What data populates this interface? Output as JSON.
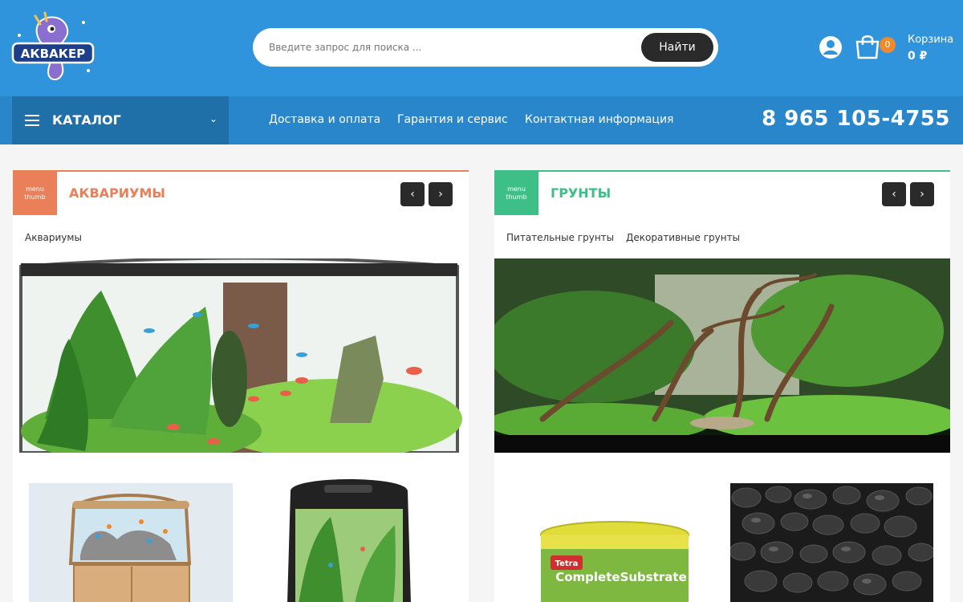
{
  "header": {
    "logo_text": "АКВАКЕР",
    "search": {
      "placeholder": "Введите запрос для поиска ...",
      "button_label": "Найти"
    },
    "cart": {
      "count": "0",
      "label": "Корзина",
      "sum": "0 ₽"
    }
  },
  "nav": {
    "catalog_label": "КАТАЛОГ",
    "links": [
      "Доставка и оплата",
      "Гарантия и сервис",
      "Контактная информация"
    ],
    "phone": "8 965 105-4755"
  },
  "panels": [
    {
      "thumb_label": "menu thumb",
      "title": "АКВАРИУМЫ",
      "subcategories": [
        "Аквариумы"
      ],
      "accent": "#e9805a"
    },
    {
      "thumb_label": "menu thumb",
      "title": "ГРУНТЫ",
      "subcategories": [
        "Питательные грунты",
        "Декоративные грунты"
      ],
      "accent": "#3dbf87"
    }
  ],
  "product_labels": {
    "tetra_brand": "Tetra",
    "tetra_product": "CompleteSubstrate"
  },
  "colors": {
    "header_bg": "#2f94dc",
    "nav_bg": "#2a86cb",
    "catalog_bg": "#1f6fa9",
    "badge": "#f08a2a"
  },
  "icons": [
    "user-icon",
    "cart-icon",
    "menu-icon",
    "chevron-down-icon",
    "arrow-left-icon",
    "arrow-right-icon"
  ]
}
